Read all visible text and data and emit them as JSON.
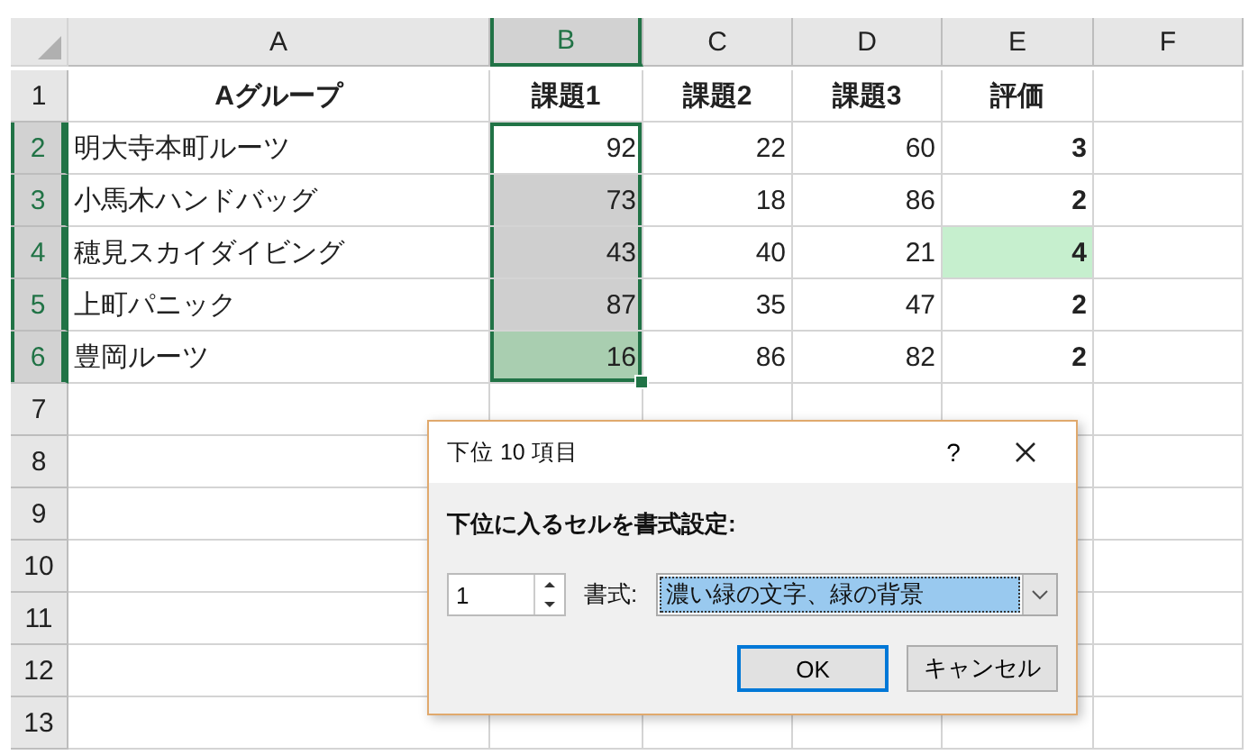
{
  "sheet": {
    "columns": [
      {
        "label": "A",
        "selected": false
      },
      {
        "label": "B",
        "selected": true
      },
      {
        "label": "C",
        "selected": false
      },
      {
        "label": "D",
        "selected": false
      },
      {
        "label": "E",
        "selected": false
      },
      {
        "label": "F",
        "selected": false
      }
    ],
    "rows": [
      {
        "header": "1",
        "selected": false,
        "cells": [
          {
            "text": "Aグループ",
            "kind": "heading",
            "selected": false,
            "active": false
          },
          {
            "text": "課題1",
            "kind": "heading",
            "selected": false,
            "active": false
          },
          {
            "text": "課題2",
            "kind": "heading",
            "selected": false,
            "active": false
          },
          {
            "text": "課題3",
            "kind": "heading",
            "selected": false,
            "active": false
          },
          {
            "text": "評価",
            "kind": "heading",
            "selected": false,
            "active": false
          }
        ]
      },
      {
        "header": "2",
        "selected": true,
        "cells": [
          {
            "text": "明大寺本町ルーツ",
            "kind": "name",
            "selected": false,
            "active": false
          },
          {
            "text": "92",
            "kind": "number",
            "selected": true,
            "active": true
          },
          {
            "text": "22",
            "kind": "number",
            "selected": false,
            "active": false
          },
          {
            "text": "60",
            "kind": "number",
            "selected": false,
            "active": false
          },
          {
            "text": "3",
            "kind": "score",
            "selected": false,
            "active": false
          }
        ]
      },
      {
        "header": "3",
        "selected": true,
        "cells": [
          {
            "text": "小馬木ハンドバッグ",
            "kind": "name",
            "selected": false,
            "active": false
          },
          {
            "text": "73",
            "kind": "number",
            "selected": true,
            "active": false
          },
          {
            "text": "18",
            "kind": "number",
            "selected": false,
            "active": false
          },
          {
            "text": "86",
            "kind": "number",
            "selected": false,
            "active": false
          },
          {
            "text": "2",
            "kind": "score",
            "selected": false,
            "active": false
          }
        ]
      },
      {
        "header": "4",
        "selected": true,
        "cells": [
          {
            "text": "穂見スカイダイビング",
            "kind": "name",
            "selected": false,
            "active": false
          },
          {
            "text": "43",
            "kind": "number",
            "selected": true,
            "active": false
          },
          {
            "text": "40",
            "kind": "number",
            "selected": false,
            "active": false
          },
          {
            "text": "21",
            "kind": "number",
            "selected": false,
            "active": false
          },
          {
            "text": "4",
            "kind": "score-good",
            "selected": false,
            "active": false
          }
        ]
      },
      {
        "header": "5",
        "selected": true,
        "cells": [
          {
            "text": "上町パニック",
            "kind": "name",
            "selected": false,
            "active": false
          },
          {
            "text": "87",
            "kind": "number",
            "selected": true,
            "active": false
          },
          {
            "text": "35",
            "kind": "number",
            "selected": false,
            "active": false
          },
          {
            "text": "47",
            "kind": "number",
            "selected": false,
            "active": false
          },
          {
            "text": "2",
            "kind": "score",
            "selected": false,
            "active": false
          }
        ]
      },
      {
        "header": "6",
        "selected": true,
        "cells": [
          {
            "text": "豊岡ルーツ",
            "kind": "name",
            "selected": false,
            "active": false
          },
          {
            "text": "16",
            "kind": "number-good",
            "selected": true,
            "active": false
          },
          {
            "text": "86",
            "kind": "number",
            "selected": false,
            "active": false
          },
          {
            "text": "82",
            "kind": "number",
            "selected": false,
            "active": false
          },
          {
            "text": "2",
            "kind": "score",
            "selected": false,
            "active": false
          }
        ]
      },
      {
        "header": "7",
        "selected": false,
        "cells": []
      },
      {
        "header": "8",
        "selected": false,
        "cells": []
      },
      {
        "header": "9",
        "selected": false,
        "cells": []
      },
      {
        "header": "10",
        "selected": false,
        "cells": []
      },
      {
        "header": "11",
        "selected": false,
        "cells": []
      },
      {
        "header": "12",
        "selected": false,
        "cells": []
      },
      {
        "header": "13",
        "selected": false,
        "cells": []
      }
    ]
  },
  "dialog": {
    "title": "下位 10 項目",
    "help": "?",
    "prompt": "下位に入るセルを書式設定:",
    "count": "1",
    "format_label": "書式:",
    "format_value": "濃い緑の文字、緑の背景",
    "buttons": [
      {
        "label": "OK",
        "default": true
      },
      {
        "label": "キャンセル",
        "default": false
      }
    ]
  }
}
